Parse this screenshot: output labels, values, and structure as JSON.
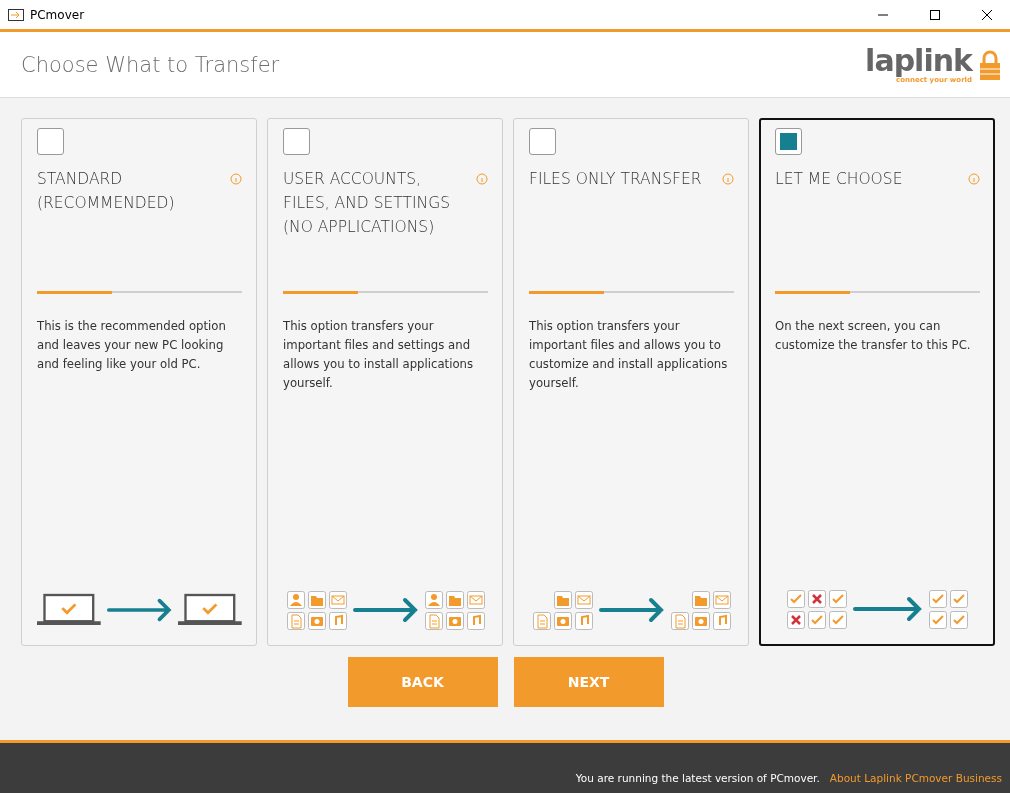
{
  "window": {
    "title": "PCmover"
  },
  "header": {
    "title": "Choose What to Transfer",
    "logo": "laplink",
    "logo_tagline": "connect your world"
  },
  "options": [
    {
      "title": "STANDARD (RECOMMENDED)",
      "selected": false,
      "description": "This is the recommended option and leaves your new PC looking and feeling like your old PC.",
      "kind": "laptops"
    },
    {
      "title": "USER ACCOUNTS, FILES, AND SETTINGS (NO APPLICATIONS)",
      "selected": false,
      "description": "This option transfers your important files and settings and allows you to install applications yourself.",
      "kind": "all-files"
    },
    {
      "title": "FILES ONLY TRANSFER",
      "selected": false,
      "description": "This option transfers your important files and allows you to customize and install applications yourself.",
      "kind": "files"
    },
    {
      "title": "LET ME CHOOSE",
      "selected": true,
      "description": "On the next screen, you can customize the transfer to this PC.",
      "kind": "choose"
    }
  ],
  "buttons": [
    {
      "label": "BACK"
    },
    {
      "label": "NEXT"
    }
  ],
  "status_bar": {
    "message": "You are running the latest version of PCmover.",
    "link": "About Laplink PCmover Business"
  }
}
